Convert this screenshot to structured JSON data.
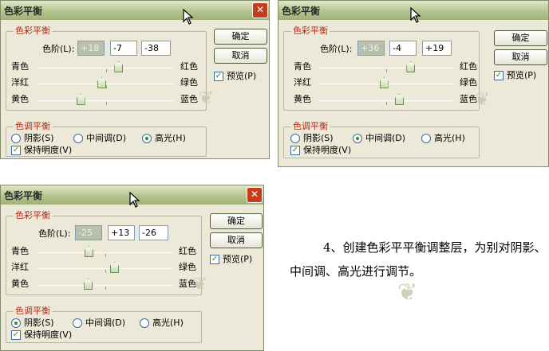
{
  "cursor_glyph": "⬉",
  "check_glyph": "✓",
  "close_glyph": "✕",
  "dialogs": [
    {
      "title": "色彩平衡",
      "color_balance_legend": "色彩平衡",
      "levels_label": "色阶(L):",
      "levels": [
        "+18",
        "-7",
        "-38"
      ],
      "slider_positions": [
        0.59,
        0.465,
        0.31
      ],
      "sliders": [
        {
          "left": "青色",
          "right": "红色"
        },
        {
          "left": "洋红",
          "right": "绿色"
        },
        {
          "left": "黄色",
          "right": "蓝色"
        }
      ],
      "tone_legend": "色调平衡",
      "tones": [
        "阴影(S)",
        "中间调(D)",
        "高光(H)"
      ],
      "tone_selected": "高光(H)",
      "preserve_label": "保持明度(V)",
      "preserve_checked": true,
      "ok_label": "确定",
      "cancel_label": "取消",
      "preview_label": "预览(P)",
      "preview_checked": true
    },
    {
      "title": "色彩平衡",
      "color_balance_legend": "色彩平衡",
      "levels_label": "色阶(L):",
      "levels": [
        "+36",
        "-4",
        "+19"
      ],
      "slider_positions": [
        0.68,
        0.48,
        0.595
      ],
      "sliders": [
        {
          "left": "青色",
          "right": "红色"
        },
        {
          "left": "洋红",
          "right": "绿色"
        },
        {
          "left": "黄色",
          "right": "蓝色"
        }
      ],
      "tone_legend": "色调平衡",
      "tones": [
        "阴影(S)",
        "中间调(D)",
        "高光(H)"
      ],
      "tone_selected": "中间调(D)",
      "preserve_label": "保持明度(V)",
      "preserve_checked": true,
      "ok_label": "确定",
      "cancel_label": "取消",
      "preview_label": "预览(P)",
      "preview_checked": true
    },
    {
      "title": "色彩平衡",
      "color_balance_legend": "色彩平衡",
      "levels_label": "色阶(L):",
      "levels": [
        "-25",
        "+13",
        "-26"
      ],
      "slider_positions": [
        0.375,
        0.565,
        0.37
      ],
      "sliders": [
        {
          "left": "青色",
          "right": "红色"
        },
        {
          "left": "洋红",
          "right": "绿色"
        },
        {
          "left": "黄色",
          "right": "蓝色"
        }
      ],
      "tone_legend": "色调平衡",
      "tones": [
        "阴影(S)",
        "中间调(D)",
        "高光(H)"
      ],
      "tone_selected": "阴影(S)",
      "preserve_label": "保持明度(V)",
      "preserve_checked": true,
      "ok_label": "确定",
      "cancel_label": "取消",
      "preview_label": "预览(P)",
      "preview_checked": true
    }
  ],
  "caption": "4、创建色彩平平衡调整层，为别对阴影、中间调、高光进行调节。"
}
